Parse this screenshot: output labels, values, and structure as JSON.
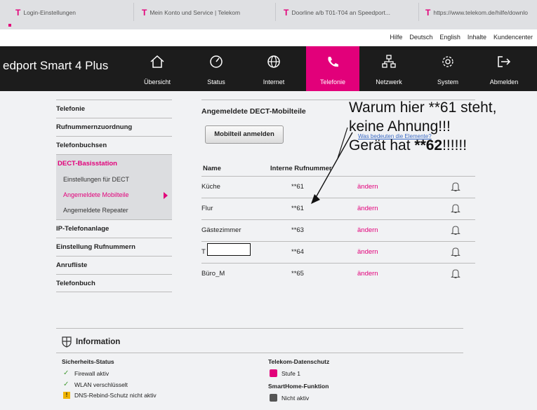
{
  "browser": {
    "tabs": [
      {
        "label": "Login-Einstellungen"
      },
      {
        "label": "Mein Konto und Service | Telekom"
      },
      {
        "label": "Doorline a/b T01-T04 an Speedport..."
      },
      {
        "label": "https://www.telekom.de/hilfe/downlo"
      }
    ],
    "tab_logo": "T"
  },
  "utility_links": [
    "Hilfe",
    "Deutsch",
    "English",
    "Inhalte",
    "Kundencenter"
  ],
  "brand": "edport Smart 4 Plus",
  "nav": [
    {
      "label": "Übersicht",
      "icon": "home-icon"
    },
    {
      "label": "Status",
      "icon": "gauge-icon"
    },
    {
      "label": "Internet",
      "icon": "globe-icon"
    },
    {
      "label": "Telefonie",
      "icon": "phone-icon",
      "active": true
    },
    {
      "label": "Netzwerk",
      "icon": "network-icon"
    },
    {
      "label": "System",
      "icon": "gear-icon"
    },
    {
      "label": "Abmelden",
      "icon": "logout-icon"
    }
  ],
  "sidebar": {
    "items": [
      "Telefonie",
      "Rufnummernzuordnung",
      "Telefonbuchsen"
    ],
    "group": {
      "head": "DECT-Basisstation",
      "subs": [
        "Einstellungen für DECT",
        "Angemeldete Mobilteile",
        "Angemeldete Repeater"
      ]
    },
    "items_after": [
      "IP-Telefonanlage",
      "Einstellung Rufnummern",
      "Anrufliste",
      "Telefonbuch"
    ]
  },
  "main": {
    "title": "Angemeldete DECT-Mobilteile",
    "register_button": "Mobilteil anmelden",
    "help_link": "Was bedeuten die Elemente?",
    "columns": [
      "Name",
      "Interne Rufnummer"
    ],
    "rows": [
      {
        "name": "Küche",
        "number": "**61",
        "action": "ändern"
      },
      {
        "name": "Flur",
        "number": "**61",
        "action": "ändern"
      },
      {
        "name": "Gästezimmer",
        "number": "**63",
        "action": "ändern"
      },
      {
        "name": "T",
        "number": "**64",
        "action": "ändern"
      },
      {
        "name": "Büro_M",
        "number": "**65",
        "action": "ändern"
      }
    ]
  },
  "annotation": {
    "line1": "Warum hier **61 steht,",
    "line2": "keine Ahnung!!!",
    "line3_pre": "Gerät hat ",
    "line3_bold": "**62",
    "line3_post": "!!!!!!"
  },
  "info": {
    "title": "Information",
    "security": {
      "head": "Sicherheits-Status",
      "lines": [
        "Firewall aktiv",
        "WLAN verschlüsselt",
        "DNS-Rebind-Schutz nicht aktiv"
      ]
    },
    "privacy": {
      "head": "Telekom-Datenschutz",
      "value": "Stufe 1"
    },
    "smarthome": {
      "head": "SmartHome-Funktion",
      "value": "Nicht aktiv"
    }
  },
  "colors": {
    "accent": "#e2007a",
    "nav_bg": "#1c1c1c",
    "ok": "#4a9e3b",
    "warn": "#f0b400"
  }
}
